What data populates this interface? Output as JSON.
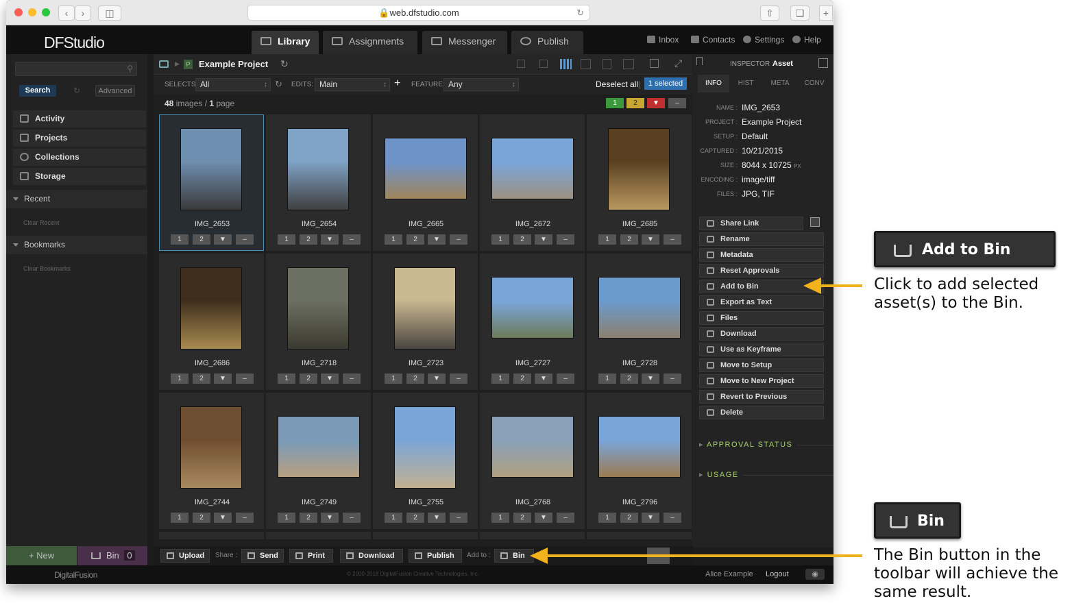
{
  "browser": {
    "url": "web.dfstudio.com"
  },
  "app": {
    "logo": "DFStudio",
    "tabs": [
      {
        "label": "Library",
        "active": true
      },
      {
        "label": "Assignments"
      },
      {
        "label": "Messenger"
      },
      {
        "label": "Publish"
      }
    ],
    "top_links": [
      "Inbox",
      "Contacts",
      "Settings",
      "Help"
    ]
  },
  "left_panel": {
    "search_button": "Search",
    "advanced_button": "Advanced",
    "nav": [
      "Activity",
      "Projects",
      "Collections",
      "Storage"
    ],
    "recent_label": "Recent",
    "clear_recent": "Clear Recent",
    "bookmarks_label": "Bookmarks",
    "clear_bookmarks": "Clear Bookmarks",
    "new_button": "+ New",
    "bin_button": "Bin",
    "bin_count": "0"
  },
  "main": {
    "project_badge": "P",
    "project_title": "Example Project",
    "selects_label": "SELECTS:",
    "selects_value": "All",
    "edits_label": "EDITS:",
    "edits_value": "Main",
    "feature_label": "FEATURE:",
    "feature_value": "Any",
    "deselect_all": "Deselect all",
    "separator": "|",
    "selected_badge": "1 selected",
    "image_count": "48",
    "images_word": "images",
    "slash": "/",
    "page_count": "1",
    "page_word": "page",
    "rating_filters": {
      "green": "1",
      "yellow": "2",
      "red": "",
      "gray": "–"
    },
    "rating_buttons": [
      "1",
      "2",
      "",
      "–"
    ],
    "images": [
      "IMG_2653",
      "IMG_2654",
      "IMG_2665",
      "IMG_2672",
      "IMG_2685",
      "IMG_2686",
      "IMG_2718",
      "IMG_2723",
      "IMG_2727",
      "IMG_2728",
      "IMG_2744",
      "IMG_2749",
      "IMG_2755",
      "IMG_2768",
      "IMG_2796"
    ]
  },
  "inspector": {
    "title_prefix": "INSPECTOR :",
    "title_value": "Asset",
    "tabs": [
      "INFO",
      "HIST",
      "META",
      "CONV"
    ],
    "fields": [
      {
        "label": "NAME :",
        "value": "IMG_2653"
      },
      {
        "label": "PROJECT :",
        "value": "Example Project"
      },
      {
        "label": "SETUP :",
        "value": "Default"
      },
      {
        "label": "CAPTURED :",
        "value": "10/21/2015"
      },
      {
        "label": "SIZE :",
        "value": "8044 x 10725",
        "unit": "PX"
      },
      {
        "label": "ENCODING :",
        "value": "image/tiff"
      },
      {
        "label": "FILES :",
        "value": "JPG, TIF"
      }
    ],
    "actions": [
      "Share Link",
      "Rename",
      "Metadata",
      "Reset Approvals",
      "Add to Bin",
      "Export as Text",
      "Files",
      "Download",
      "Use as Keyframe",
      "Move to Setup",
      "Move to New Project",
      "Revert to Previous",
      "Delete"
    ],
    "approval_status": "APPROVAL STATUS",
    "usage": "USAGE"
  },
  "toolbar": {
    "upload": "Upload",
    "share_label": "Share :",
    "send": "Send",
    "print": "Print",
    "download": "Download",
    "publish": "Publish",
    "add_to_label": "Add to :",
    "bin": "Bin"
  },
  "footer": {
    "brand": "DigitalFusion",
    "copyright": "© 2000-2018 DigitalFusion Creative Technologies, Inc.",
    "user": "Alice Example",
    "logout": "Logout"
  },
  "annotations": {
    "add_to_bin_callout": "Add to Bin",
    "add_to_bin_text_1": "Click to add selected",
    "add_to_bin_text_2": "asset(s) to the Bin.",
    "bin_callout": "Bin",
    "bin_text_1": "The Bin button in the",
    "bin_text_2": "toolbar will achieve the",
    "bin_text_3": "same result."
  },
  "colors": {
    "accent_blue": "#2f6fae",
    "approval_green": "#a8d46a",
    "arrow_yellow": "#f2b21b"
  }
}
